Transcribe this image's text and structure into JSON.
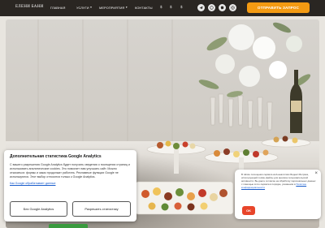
{
  "header": {
    "logo": "ЕЛЕНИ БАНИ",
    "nav": [
      {
        "label": "ГЛАВНАЯ",
        "dropdown": false
      },
      {
        "label": "УСЛУГИ",
        "dropdown": true
      },
      {
        "label": "МЕРОПРИЯТИЯ",
        "dropdown": true
      },
      {
        "label": "КОНТАКТЫ",
        "dropdown": false
      }
    ],
    "currencies": [
      "$",
      "$",
      "$"
    ],
    "social_icons": [
      "telegram-icon",
      "whatsapp-icon",
      "viber-icon",
      "instagram-icon"
    ],
    "cta_label": "ОТПРАВИТЬ ЗАПРОС",
    "cta_color": "#f39a12"
  },
  "cookie_banner": {
    "title": "Дополнительная статистика Google Analytics",
    "text": "С вашего разрешения Google Analytics будет получать сведения о посещении страниц и использовать аналитические cookies. Это помогает нам улучшать сайт. Можно отказаться: формы и заказ продолжат работать. Рекламные функции Google не используются. Этот выбор относится только к Google Analytics.",
    "link": "Как Google обрабатывает данные",
    "deny_label": "Без Google Analytics",
    "allow_label": "Разрешить статистику"
  },
  "metrika_notice": {
    "text_before_link": "В rabote пoсещения сервиса web-аналитики Яндекс.Метрика, использующий cookie-файлы для анализа пользовательской активности. Вы даете согласие на обработку персональных данных с помощью этого сервиса в порядке, указанном в",
    "link": "Политике конфиденциальности",
    "ok_label": "OK",
    "ok_color": "#e8452a"
  }
}
